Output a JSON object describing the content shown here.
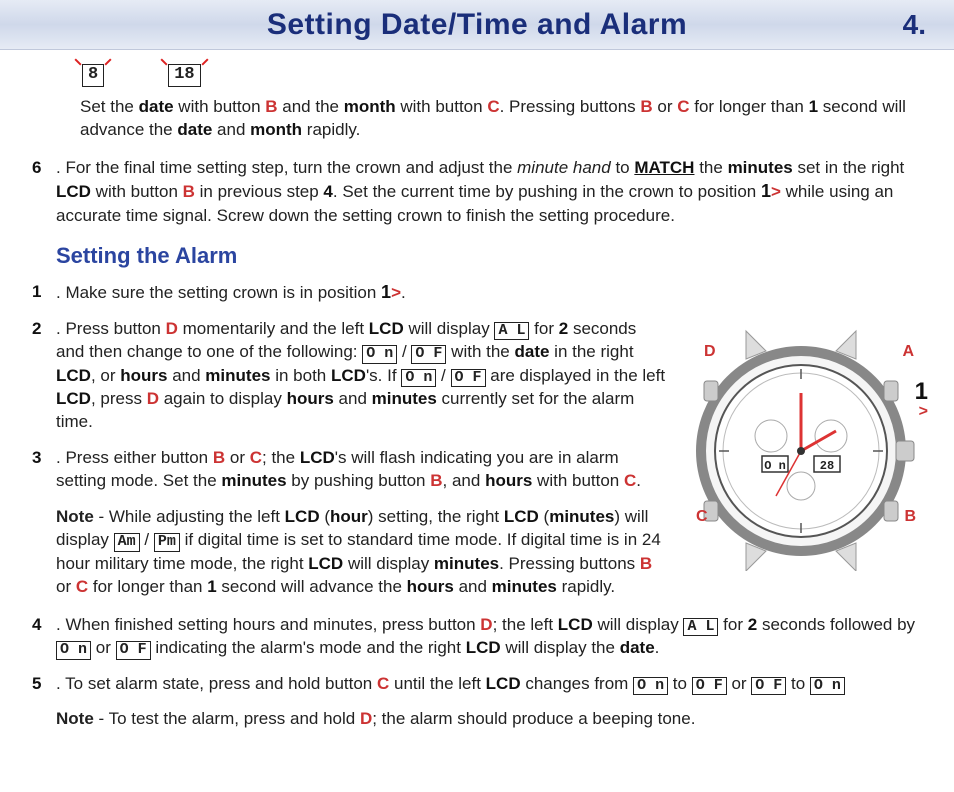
{
  "header": {
    "title": "Setting Date/Time and Alarm",
    "page_number": "4."
  },
  "top_lcds": {
    "left": " 8",
    "right": " 18"
  },
  "intro_para": {
    "p1a": "Set the ",
    "date_b": "date",
    "p1b": " with button ",
    "btn_b1": "B",
    "p1c": " and the ",
    "month_b": "month",
    "p1d": " with button ",
    "btn_c1": "C",
    "p1e": ".  Pressing buttons ",
    "btn_b2": "B",
    "p1f": " or ",
    "btn_c2": "C",
    "p1g": " for longer than ",
    "one_b": "1",
    "p1h": " second will advance the ",
    "date_b2": "date",
    "p1i": " and ",
    "month_b2": "month",
    "p1j": " rapidly."
  },
  "step6": {
    "num": "6",
    "a": ". For the final time setting step, turn the crown and adjust the ",
    "minute_hand_i": "minute hand",
    "b": " to ",
    "match_u": "MATCH",
    "c": " the ",
    "minutes_b": "minutes",
    "d": " set in the right ",
    "lcd_b": "LCD",
    "e": " with button ",
    "btn_b": "B",
    "f": " in previous step ",
    "four_b": "4",
    "g": ". Set the current time by pushing in the crown to position ",
    "pos1": "1",
    "chev": ">",
    "h": " while using an accurate time signal. Screw down the setting crown to finish the setting procedure."
  },
  "section_heading": "Setting the Alarm",
  "alarm1": {
    "num": "1",
    "a": ". Make sure the setting crown is in position ",
    "pos1": "1",
    "chev": ">",
    "b": "."
  },
  "alarm2": {
    "num": "2",
    "a": ". Press button ",
    "btn_d1": "D",
    "b": " momentarily and the left ",
    "lcd_b1": "LCD",
    "c": " will display ",
    "lcd_al": "A L",
    "d": " for ",
    "two_b": "2",
    "e": " seconds and then change to one of the following: ",
    "lcd_on": "O n",
    "slash1": " / ",
    "lcd_of": "O F",
    "f": "  with the ",
    "date_b": "date",
    "g": " in the right ",
    "lcd_b2": "LCD",
    "h": ", or ",
    "hours_b": "hours",
    "i": " and ",
    "minutes_b": "minutes",
    "j": " in both ",
    "lcd_b3": "LCD",
    "k": "'s.  If ",
    "lcd_on2": "O n",
    "slash2": " / ",
    "lcd_of2": "O F",
    "l": " are displayed in the left ",
    "lcd_b4": "LCD",
    "m": ", press ",
    "btn_d2": "D",
    "n": " again to display ",
    "hours_b2": "hours",
    "o": " and ",
    "minutes_b2": "minutes",
    "p": " currently set for the alarm time."
  },
  "alarm3": {
    "num": "3",
    "a": ". Press either button ",
    "btn_b": "B",
    "b": " or ",
    "btn_c": "C",
    "c": "; the ",
    "lcd_b": "LCD",
    "d": "'s will flash indicating you are in alarm setting mode. Set the ",
    "minutes_b": "minutes",
    "e": " by pushing button ",
    "btn_b2": "B",
    "f": ", and ",
    "hours_b": "hours",
    "g": " with button ",
    "btn_c2": "C",
    "h": "."
  },
  "note1": {
    "label": "Note",
    "a": " - While adjusting the left ",
    "lcd_b1": "LCD",
    "b": " (",
    "hour_b": "hour",
    "c": ") setting, the right ",
    "lcd_b2": "LCD",
    "d": " (",
    "minutes_b": "minutes",
    "e": ") will display ",
    "am": "Am",
    "slash": " / ",
    "pm": "Pm",
    "f": " if digital time is set to standard time mode. If digital time is in 24 hour military time mode, the right ",
    "lcd_b3": "LCD",
    "g": " will display ",
    "minutes_b2": "minutes",
    "h": ". Pressing buttons ",
    "btn_b": "B",
    "i": " or ",
    "btn_c": "C",
    "j": " for longer than ",
    "one_b": "1",
    "k": " second will advance the ",
    "hours_b2": "hours",
    "l": " and ",
    "minutes_b3": "minutes",
    "m": " rapidly."
  },
  "alarm4": {
    "num": "4",
    "a": ". When finished setting hours and minutes, press button ",
    "btn_d": "D",
    "b": "; the left ",
    "lcd_b1": "LCD",
    "c": " will display ",
    "lcd_al": "A L",
    "d": "  for ",
    "two_b": "2",
    "e": " seconds followed by ",
    "lcd_on": "O n",
    "or": " or ",
    "lcd_of": "O F",
    "f": " indicating the alarm's mode and the right ",
    "lcd_b2": "LCD",
    "g": " will display the ",
    "date_b": "date",
    "h": "."
  },
  "alarm5": {
    "num": "5",
    "a": ". To set alarm state, press and hold button ",
    "btn_c": "C",
    "b": " until the left ",
    "lcd_b": "LCD",
    "c": " changes from ",
    "lcd_on1": "O n",
    "to1": " to ",
    "lcd_of1": "O F",
    "or": " or ",
    "lcd_of2": "O F",
    "to2": " to ",
    "lcd_on2": "O n"
  },
  "note2": {
    "label": "Note",
    "a": " - To test the alarm, press and hold ",
    "btn_d": "D",
    "b": "; the alarm should produce a beeping tone."
  },
  "watch": {
    "D": "D",
    "A": "A",
    "C": "C",
    "B": "B",
    "one": "1",
    "chev": ">",
    "lcd_left": "O n",
    "lcd_right": "28"
  }
}
